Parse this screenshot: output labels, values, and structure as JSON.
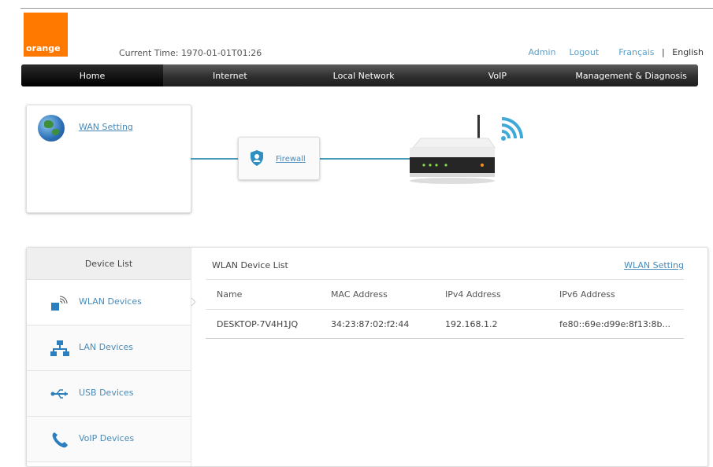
{
  "header": {
    "logo_text": "orange",
    "current_time_label": "Current Time:",
    "current_time_value": "1970-01-01T01:26",
    "links": {
      "admin": "Admin",
      "logout": "Logout",
      "francais": "Français",
      "separator": "|",
      "english": "English"
    }
  },
  "nav": {
    "tabs": [
      {
        "label": "Home",
        "active": true
      },
      {
        "label": "Internet"
      },
      {
        "label": "Local Network"
      },
      {
        "label": "VoIP"
      },
      {
        "label": "Management & Diagnosis"
      }
    ]
  },
  "topology": {
    "wan_setting_label": "WAN Setting",
    "firewall_label": "Firewall"
  },
  "device_list": {
    "sidebar_title": "Device List",
    "items": [
      {
        "label": "WLAN Devices",
        "icon": "wlan-icon",
        "active": true
      },
      {
        "label": "LAN Devices",
        "icon": "lan-icon"
      },
      {
        "label": "USB Devices",
        "icon": "usb-icon"
      },
      {
        "label": "VoIP Devices",
        "icon": "phone-icon"
      }
    ],
    "list_title": "WLAN Device List",
    "wlan_setting_link": "WLAN Setting",
    "columns": [
      "Name",
      "MAC Address",
      "IPv4 Address",
      "IPv6 Address"
    ],
    "rows": [
      [
        "DESKTOP-7V4H1JQ",
        "34:23:87:02:f2:44",
        "192.168.1.2",
        "fe80::69e:d99e:8f13:8b..."
      ]
    ]
  },
  "colors": {
    "brand_orange": "#ff7900",
    "link_blue": "#4a8ab8",
    "connector": "#4a9bb8",
    "wifi_blue": "#3fa9d8"
  }
}
